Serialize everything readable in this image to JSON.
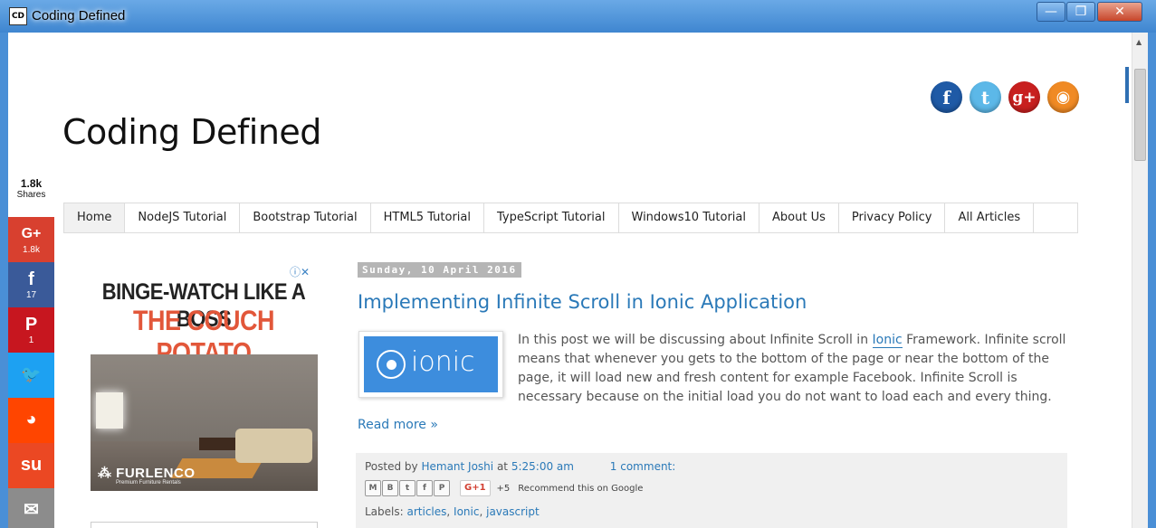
{
  "window": {
    "title": "Coding Defined",
    "icon_text": "CD",
    "minimize": "—",
    "maximize": "❐",
    "close": "✕"
  },
  "header": {
    "site_title": "Coding Defined",
    "social_icons": [
      {
        "name": "facebook-icon",
        "glyph": "f",
        "color": "#1f5aa6"
      },
      {
        "name": "twitter-icon",
        "glyph": "t",
        "color": "#5cb8e8"
      },
      {
        "name": "google-plus-icon",
        "glyph": "g+",
        "color": "#c8201f"
      },
      {
        "name": "rss-icon",
        "glyph": "◉",
        "color": "#f08a24"
      }
    ]
  },
  "share_bar": {
    "count": "1.8k",
    "count_label": "Shares",
    "items": [
      {
        "name": "share-google-plus",
        "icon": "G+",
        "count": "1.8k",
        "color": "#d8402f"
      },
      {
        "name": "share-facebook",
        "icon": "f",
        "count": "17",
        "color": "#3a5a99"
      },
      {
        "name": "share-pinterest",
        "icon": "P",
        "count": "1",
        "color": "#c7161f"
      },
      {
        "name": "share-twitter",
        "icon": "🐦",
        "count": "",
        "color": "#1da1f2"
      },
      {
        "name": "share-reddit",
        "icon": "◕",
        "count": "",
        "color": "#ff4500"
      },
      {
        "name": "share-stumbleupon",
        "icon": "su",
        "count": "",
        "color": "#eb4823"
      },
      {
        "name": "share-email",
        "icon": "✉",
        "count": "",
        "color": "#8c8c8c"
      }
    ]
  },
  "nav": {
    "items": [
      "Home",
      "NodeJS Tutorial",
      "Bootstrap Tutorial",
      "HTML5 Tutorial",
      "TypeScript Tutorial",
      "Windows10 Tutorial",
      "About Us",
      "Privacy Policy",
      "All Articles"
    ],
    "active": "Home"
  },
  "ad": {
    "choices_icon": "ⓘ✕",
    "line1": "BINGE-WATCH LIKE A BOSS",
    "line2": "THE COUCH POTATO",
    "brand": "⁂ FURLENCO",
    "sub": "Premium Furniture Rentals"
  },
  "post": {
    "date": "Sunday, 10 April 2016",
    "title": "Implementing Infinite Scroll in Ionic Application",
    "thumb_word": "ionic",
    "body_before": "In this post we will be discussing about Infinite Scroll in ",
    "body_link": "Ionic",
    "body_after": " Framework. Infinite scroll means that whenever you gets to the bottom of the page or near the bottom of the page, it will load new and fresh content for example Facebook. Infinite Scroll is necessary because on the initial load you do not want to load each and every thing.",
    "read_more": "Read more »",
    "footer": {
      "posted_by": "Posted by",
      "author": "Hemant Joshi",
      "at": "at",
      "time": "5:25:00 am",
      "comments": "1 comment:",
      "share_buttons": [
        "M",
        "B",
        "t",
        "f",
        "P"
      ],
      "gplus_label": "G+1",
      "gplus_count": "+5",
      "gplus_text": "Recommend this on Google",
      "labels_prefix": "Labels:",
      "labels": [
        "articles",
        "Ionic",
        "javascript"
      ]
    }
  }
}
